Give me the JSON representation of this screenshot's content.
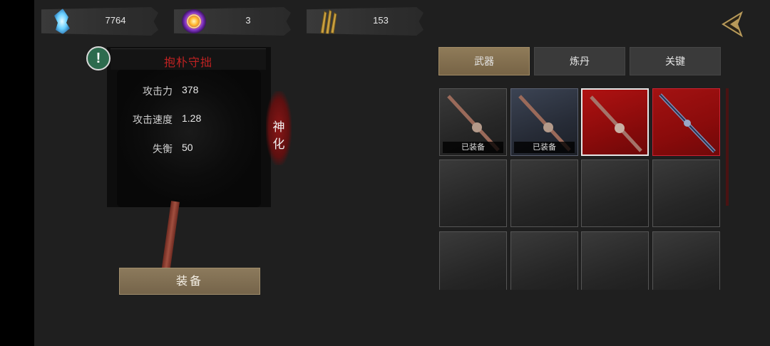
{
  "resources": [
    {
      "icon": "blue-crystal-icon",
      "value": "7764"
    },
    {
      "icon": "purple-orb-icon",
      "value": "3"
    },
    {
      "icon": "golden-arrows-icon",
      "value": "153"
    }
  ],
  "weapon": {
    "name": "抱朴守拙",
    "stats": [
      {
        "label": "攻击力",
        "value": "378"
      },
      {
        "label": "攻击速度",
        "value": "1.28"
      },
      {
        "label": "失衡",
        "value": "50"
      }
    ],
    "awaken_label": "神化"
  },
  "equip_label": "装备",
  "tabs": [
    {
      "label": "武器",
      "active": true
    },
    {
      "label": "炼丹",
      "active": false
    },
    {
      "label": "关键",
      "active": false
    }
  ],
  "items": [
    {
      "style": "gray",
      "badge": "已装备"
    },
    {
      "style": "blue",
      "badge": "已装备"
    },
    {
      "style": "red-selected",
      "badge": ""
    },
    {
      "style": "red",
      "badge": ""
    }
  ],
  "colors": {
    "accent_gold": "#8f7b59",
    "accent_red": "#c02222"
  }
}
